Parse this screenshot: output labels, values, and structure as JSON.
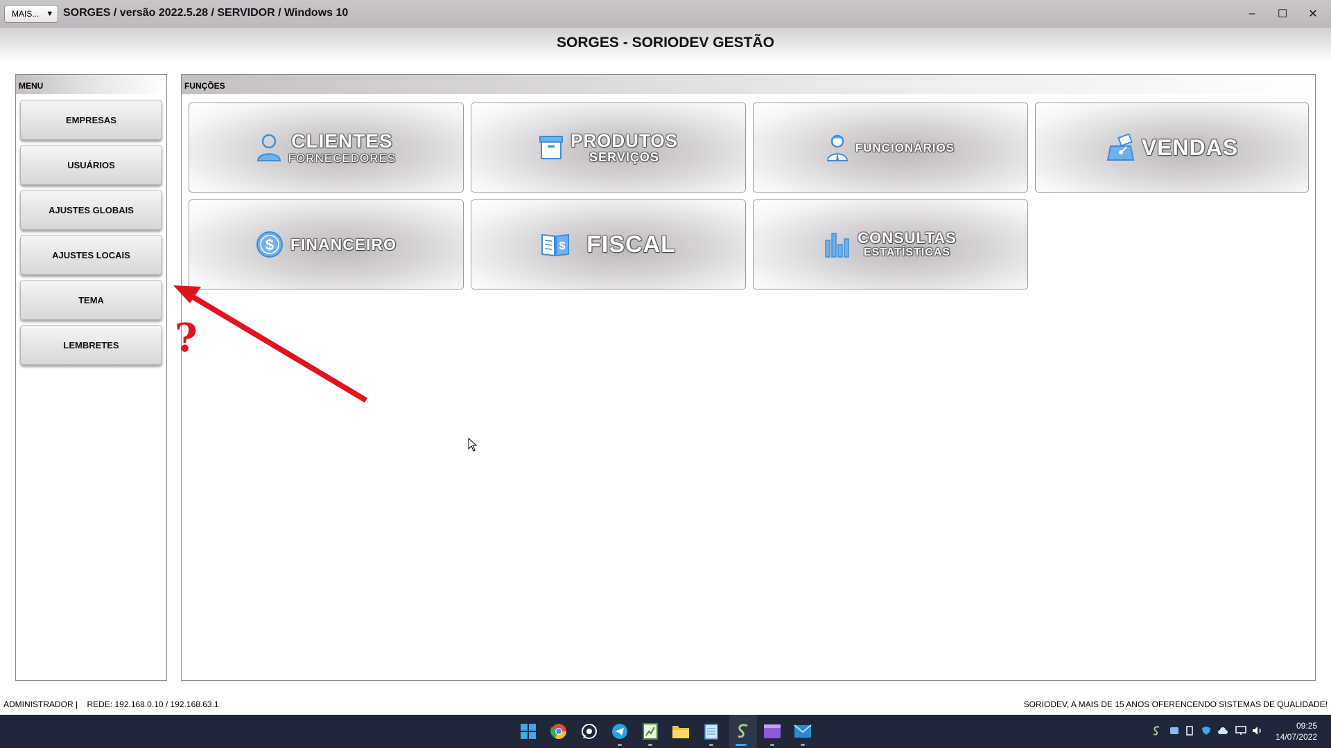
{
  "window": {
    "mais_label": "MAIS...",
    "mais_arrow": "▼",
    "title": "SORGES / versão 2022.5.28 / SERVIDOR / Windows 10",
    "minimize": "–",
    "maximize": "☐",
    "close": "✕"
  },
  "app": {
    "title": "SORGES - SORIODEV GESTÃO"
  },
  "menu": {
    "header": "MENU",
    "items": [
      {
        "label": "EMPRESAS"
      },
      {
        "label": "USUÁRIOS"
      },
      {
        "label": "AJUSTES GLOBAIS"
      },
      {
        "label": "AJUSTES LOCAIS"
      },
      {
        "label": "TEMA"
      },
      {
        "label": "LEMBRETES"
      }
    ]
  },
  "functions": {
    "header": "FUNÇÕES",
    "tiles": [
      {
        "main": "CLIENTES",
        "sub": "FORNECEDORES",
        "icon": "person-icon"
      },
      {
        "main": "PRODUTOS",
        "sub": "SERVIÇOS",
        "icon": "box-icon"
      },
      {
        "main": "FUNCIONÁRIOS",
        "sub": "",
        "icon": "employee-icon"
      },
      {
        "main": "VENDAS",
        "sub": "",
        "icon": "cash-register-icon"
      },
      {
        "main": "FINANCEIRO",
        "sub": "",
        "icon": "dollar-coin-icon"
      },
      {
        "main": "FISCAL",
        "sub": "",
        "icon": "fiscal-book-icon"
      },
      {
        "main": "CONSULTAS",
        "sub": "ESTATÍSTICAS",
        "icon": "bar-chart-icon"
      }
    ]
  },
  "annotation": {
    "mark": "?",
    "color": "#e0141c"
  },
  "status": {
    "left": "ADMINISTRADOR |    REDE: 192.168.0.10 / 192.168.63.1",
    "right": "SORIODEV, A MAIS DE 15 ANOS OFERENCENDO SISTEMAS DE QUALIDADE!"
  },
  "taskbar": {
    "apps": [
      "windows-start-icon",
      "chrome-icon",
      "whatsapp-icon",
      "telegram-icon",
      "spreadsheet-icon",
      "file-explorer-icon",
      "notepad-icon",
      "sorges-app-icon",
      "media-icon",
      "mail-icon"
    ],
    "tray": [
      "app-tray-icon",
      "teams-tray-icon",
      "usb-tray-icon",
      "security-tray-icon",
      "cloud-tray-icon",
      "network-tray-icon",
      "volume-tray-icon"
    ],
    "time": "09:25",
    "date": "14/07/2022"
  },
  "colors": {
    "taskbar": "#1f2738",
    "icon_blue": "#3b8fd9",
    "annotation_red": "#e0141c"
  }
}
